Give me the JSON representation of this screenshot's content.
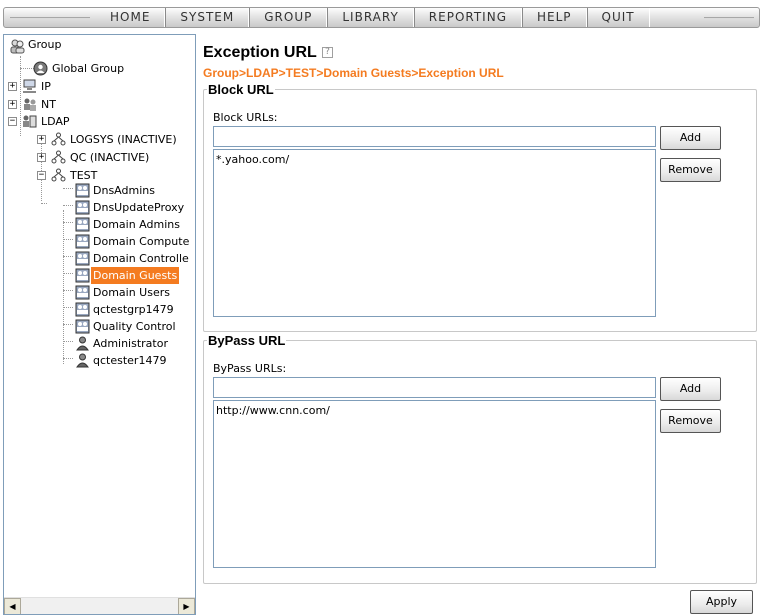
{
  "menu": {
    "items": [
      "HOME",
      "SYSTEM",
      "GROUP",
      "LIBRARY",
      "REPORTING",
      "HELP",
      "QUIT"
    ]
  },
  "tree": {
    "root": "Group",
    "global_group": "Global Group",
    "ip": "IP",
    "nt": "NT",
    "ldap": "LDAP",
    "logsys": "LOGSYS (INACTIVE)",
    "qc": "QC (INACTIVE)",
    "test": "TEST",
    "groups": [
      "DnsAdmins",
      "DnsUpdateProxy",
      "Domain Admins",
      "Domain Compute",
      "Domain Controlle",
      "Domain Guests",
      "Domain Users",
      "qctestgrp1479",
      "Quality Control"
    ],
    "selected": "Domain Guests",
    "users": [
      "Administrator",
      "qctester1479"
    ]
  },
  "page": {
    "title": "Exception URL",
    "breadcrumb": "Group>LDAP>TEST>Domain Guests>Exception URL"
  },
  "block": {
    "legend": "Block URL",
    "field_label": "Block URLs:",
    "input_value": "",
    "list": "*.yahoo.com/",
    "add_label": "Add",
    "remove_label": "Remove"
  },
  "bypass": {
    "legend": "ByPass URL",
    "field_label": "ByPass URLs:",
    "input_value": "",
    "list": "http://www.cnn.com/",
    "add_label": "Add",
    "remove_label": "Remove"
  },
  "actions": {
    "apply_label": "Apply"
  },
  "colors": {
    "accent": "#f47b20",
    "border": "#7f9db9"
  }
}
